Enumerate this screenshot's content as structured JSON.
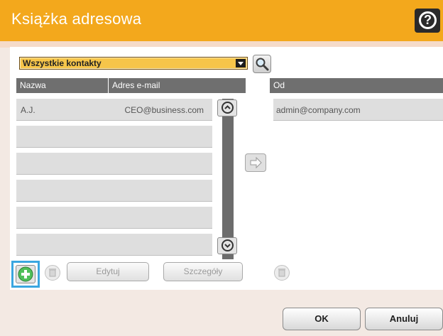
{
  "header": {
    "title": "Książka adresowa",
    "help_icon": "help-icon"
  },
  "filter": {
    "selected": "Wszystkie kontakty"
  },
  "to_table": {
    "columns": [
      "Nazwa",
      "Adres e-mail"
    ],
    "rows": [
      {
        "name": "A.J.",
        "email": "CEO@business.com"
      },
      {
        "name": "",
        "email": ""
      },
      {
        "name": "",
        "email": ""
      },
      {
        "name": "",
        "email": ""
      },
      {
        "name": "",
        "email": ""
      },
      {
        "name": "",
        "email": ""
      }
    ]
  },
  "from_table": {
    "column": "Od",
    "rows": [
      {
        "email": "admin@company.com"
      }
    ]
  },
  "toolbar": {
    "edit_label": "Edytuj",
    "details_label": "Szczegóły"
  },
  "footer": {
    "ok_label": "OK",
    "cancel_label": "Anuluj"
  },
  "colors": {
    "accent": "#f3a81c",
    "header_row": "#6f6f6f",
    "focus": "#3aa6e0",
    "add_green": "#4fbf5a"
  }
}
